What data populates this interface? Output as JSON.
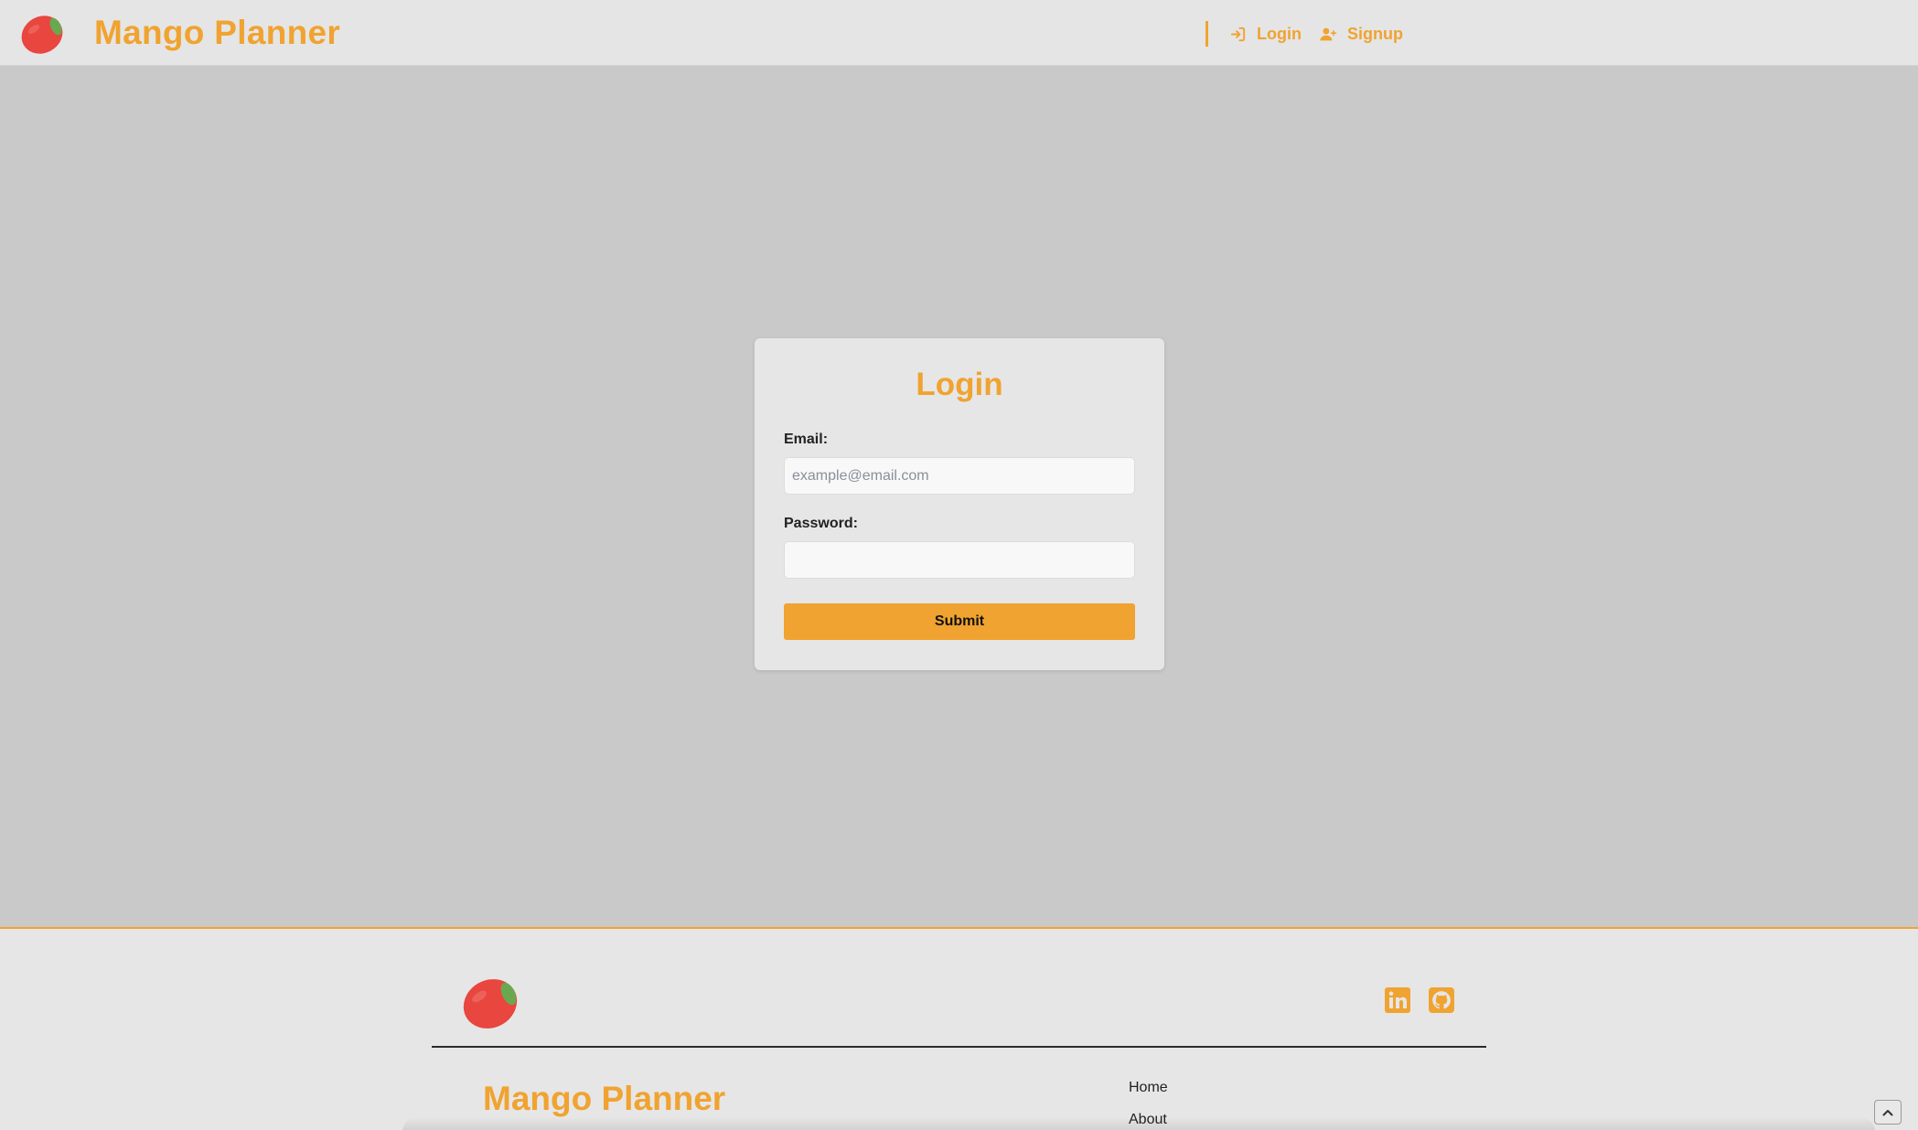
{
  "brand": {
    "name": "Mango Planner",
    "accent_color": "#f0a330",
    "logo_icon": "mango-icon"
  },
  "nav": {
    "items": [
      {
        "label": "Login",
        "icon": "sign-in-icon"
      },
      {
        "label": "Signup",
        "icon": "user-plus-icon"
      }
    ]
  },
  "login_form": {
    "title": "Login",
    "email_label": "Email:",
    "email_value": "",
    "email_placeholder": "example@email.com",
    "password_label": "Password:",
    "password_value": "",
    "submit_label": "Submit"
  },
  "footer": {
    "logo_icon": "mango-icon",
    "brand_name": "Mango Planner",
    "social": [
      {
        "icon": "linkedin-icon"
      },
      {
        "icon": "github-icon"
      }
    ],
    "links": [
      "Home",
      "About"
    ],
    "scroll_top_icon": "chevron-up-icon"
  }
}
